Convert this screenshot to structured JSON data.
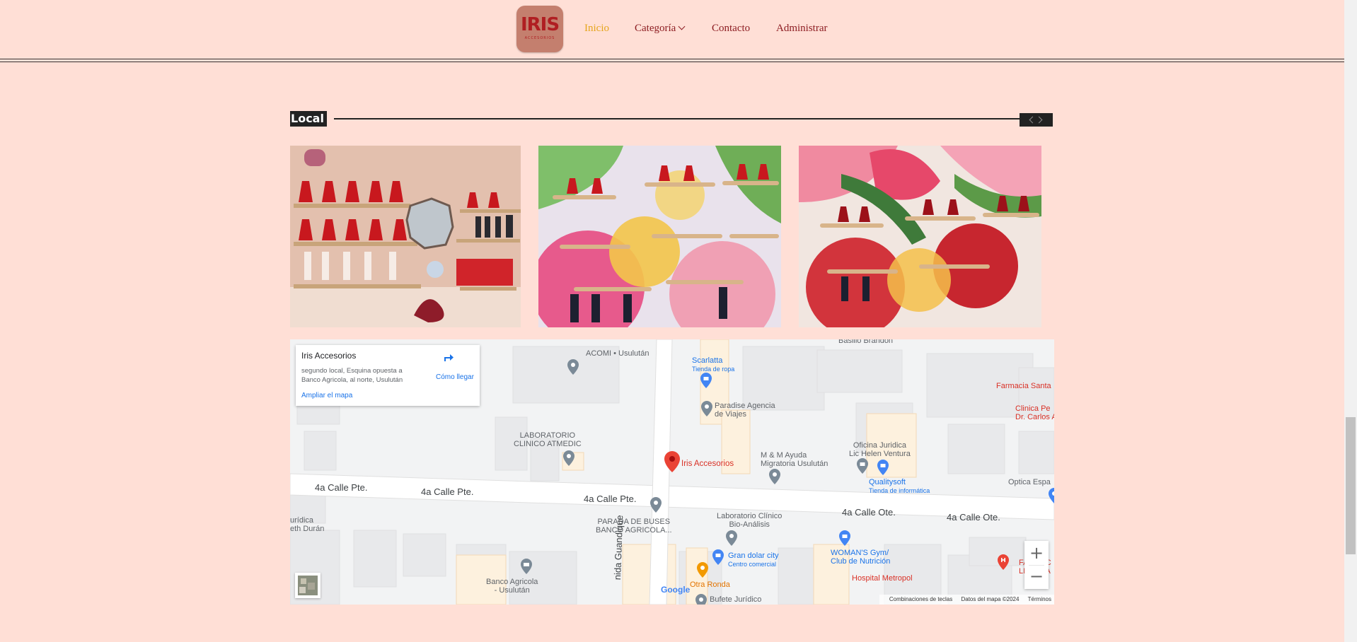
{
  "nav": {
    "logo_text": "IRIS",
    "logo_subtext": "ACCESORIOS",
    "links": [
      {
        "label": "Inicio"
      },
      {
        "label": "Categoría"
      },
      {
        "label": "Contacto"
      },
      {
        "label": "Administrar"
      }
    ]
  },
  "section": {
    "title": "Local"
  },
  "gallery": {
    "images": [
      "shop-wall-photo-1",
      "shop-wall-photo-2",
      "shop-wall-photo-3"
    ]
  },
  "map": {
    "card": {
      "name": "Iris Accesorios",
      "address": "segundo local, Esquina opuesta a Banco Agricola, al norte, Usulután",
      "directions": "Cómo llegar",
      "enlarge": "Ampliar el mapa"
    },
    "streets": [
      "4a Calle Pte.",
      "4a Calle Pte.",
      "4a Calle Pte.",
      "4a Calle Ote.",
      "4a Calle Ote.",
      "nida Guandique"
    ],
    "places": {
      "acomi": "ACOMI • Usulután",
      "scarlatta": "Scarlatta",
      "scarlatta_sub": "Tienda de ropa",
      "basilio": "Basilio Brandon",
      "farmacia_santa": "Farmacia Santa",
      "clinica_1": "Clinica Pe",
      "clinica_2": "Dr. Carlos A",
      "paradise_1": "Paradise Agencia",
      "paradise_2": "de Viajes",
      "lab_1": "LABORATORIO",
      "lab_2": "CLINICO ATMEDIC",
      "iris": "Iris Accesorios",
      "mm_1": "M & M Ayuda",
      "mm_2": "Migratoria Usulután",
      "oficina_1": "Oficina Juridica",
      "oficina_2": "Lic Helen Ventura",
      "qualitysoft": "Qualitysoft",
      "qualitysoft_sub": "Tienda de informática",
      "optica": "Optica Espa",
      "juridica_1": "urídica",
      "juridica_2": "eth Durán",
      "parada_1": "PARADA DE BUSES",
      "parada_2": "BANCO AGRICOLA...",
      "lab_bio_1": "Laboratorio Clínico",
      "lab_bio_2": "Bio-Análisis",
      "womans_1": "WOMAN'S Gym/",
      "womans_2": "Club de Nutrición",
      "farmac_1": "FARMAC",
      "farmac_2": "LIBERTA",
      "gran_dolar": "Gran dolar city",
      "gran_dolar_sub": "Centro comercial",
      "hospital": "Hospital Metropol",
      "otra_ronda": "Otra Ronda",
      "banco_1": "Banco Agricola",
      "banco_2": "- Usulután",
      "bufete": "Bufete Jurídico"
    },
    "google": "Google",
    "attribution": {
      "shortcuts": "Combinaciones de teclas",
      "data": "Datos del mapa ©2024",
      "terms": "Términos"
    },
    "zoom_in": "+",
    "zoom_out": "−"
  }
}
